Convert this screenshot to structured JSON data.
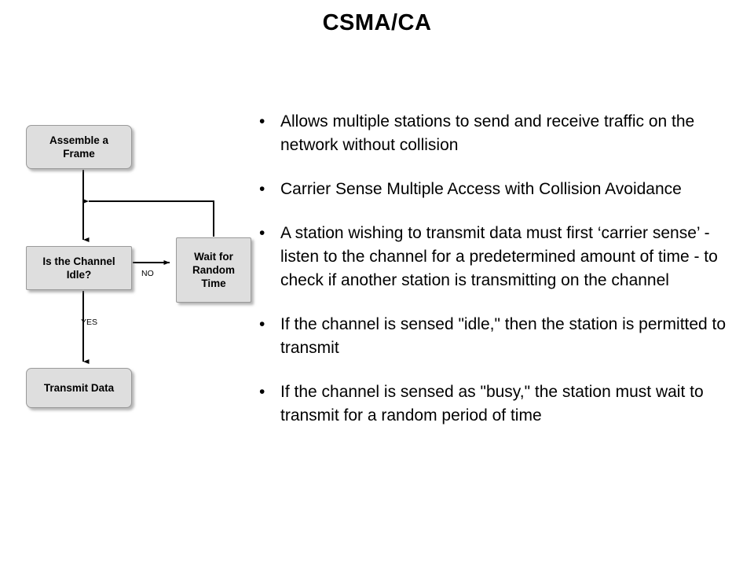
{
  "slide": {
    "title": "CSMA/CA",
    "background_color": "#ffffff",
    "text_color": "#000000"
  },
  "flowchart": {
    "box_fill_color": "#dedede",
    "box_border_color": "#9a9a9a",
    "connector_color": "#000000",
    "boxes": [
      {
        "id": "assemble",
        "label": "Assemble a\nFrame",
        "line1": "Assemble a",
        "line2": "Frame"
      },
      {
        "id": "idle",
        "label": "Is the Channel\nIdle?",
        "line1": "Is the Channel",
        "line2": "Idle?"
      },
      {
        "id": "wait",
        "label": "Wait for\nRandom\nTime",
        "line1": "Wait for",
        "line2": "Random",
        "line3": "Time"
      },
      {
        "id": "transmit",
        "label": "Transmit Data",
        "line1": "Transmit Data"
      }
    ],
    "edge_labels": {
      "no": "NO",
      "yes": "YES"
    }
  },
  "bullets": [
    {
      "marker": "•",
      "text": "Allows multiple stations to send and receive traffic on the network without collision"
    },
    {
      "marker": "•",
      "text": "Carrier Sense Multiple Access with Collision Avoidance"
    },
    {
      "marker": "•",
      "text": "A station wishing to transmit data must first ‘carrier sense’ - listen to the channel for a predetermined amount of time - to check if another station is transmitting on the channel"
    },
    {
      "marker": "•",
      "text": "If the channel is sensed \"idle,\" then the station is permitted to transmit"
    },
    {
      "marker": "•",
      "text": "If the channel is sensed as \"busy,\" the station must wait to transmit for a random period of time"
    }
  ]
}
